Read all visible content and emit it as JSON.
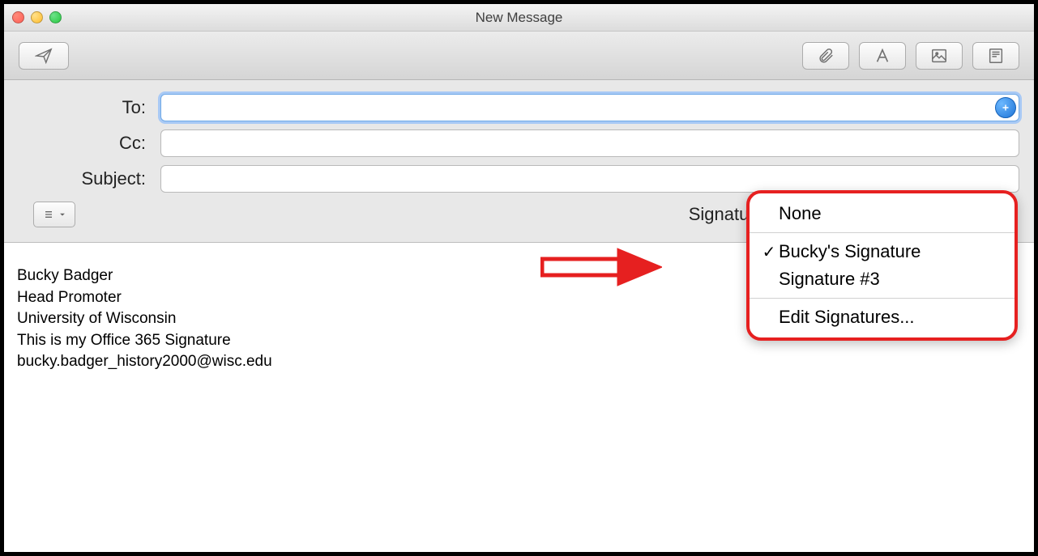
{
  "window": {
    "title": "New Message"
  },
  "fields": {
    "to": {
      "label": "To:",
      "value": ""
    },
    "cc": {
      "label": "Cc:",
      "value": ""
    },
    "subject": {
      "label": "Subject:",
      "value": ""
    }
  },
  "signature": {
    "label": "Signature:",
    "selected_index": 1,
    "menu": {
      "items": [
        {
          "label": "None"
        },
        {
          "label": "Bucky's Signature"
        },
        {
          "label": "Signature #3"
        }
      ],
      "edit_label": "Edit Signatures..."
    }
  },
  "body_lines": [
    "Bucky Badger",
    "Head Promoter",
    "University of Wisconsin",
    "This is my Office 365 Signature",
    "bucky.badger_history2000@wisc.edu"
  ],
  "icons": {
    "send": "paper-plane-icon",
    "attach": "paperclip-icon",
    "format": "font-icon",
    "photo": "photo-icon",
    "stationery": "stationery-icon",
    "options": "list-icon",
    "add": "plus-circle-icon"
  }
}
